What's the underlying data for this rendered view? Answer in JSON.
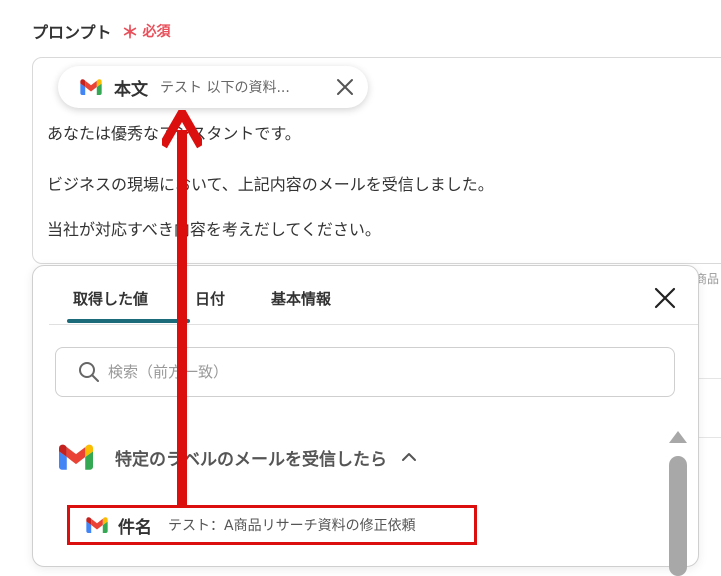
{
  "field": {
    "label": "プロンプト",
    "required_mark": "＊",
    "required_text": "必須"
  },
  "chip": {
    "icon": "gmail-icon",
    "label": "本文",
    "value": "テスト 以下の資料..."
  },
  "prompt": {
    "line1_start": "あなたは優秀な",
    "line1_end": "アシスタントです。",
    "line2": "ビジネスの現場において、上記内容のメールを受信しました。",
    "line3": "当社が対応すべき内容を考えだしてください。"
  },
  "side": {
    "text": "商品"
  },
  "panel": {
    "tabs": [
      "取得した値",
      "日付",
      "基本情報"
    ],
    "active_tab": 0,
    "search_placeholder": "検索（前方一致）",
    "group": {
      "icon": "gmail-icon",
      "title": "特定のラベルのメールを受信したら",
      "expanded": true
    },
    "item": {
      "icon": "gmail-icon",
      "label": "件名",
      "value": "テスト：A商品リサーチ資料の修正依頼"
    }
  },
  "colors": {
    "accent": "#1c6b7a",
    "required": "#e8505b",
    "highlight": "#dc0f0f"
  }
}
